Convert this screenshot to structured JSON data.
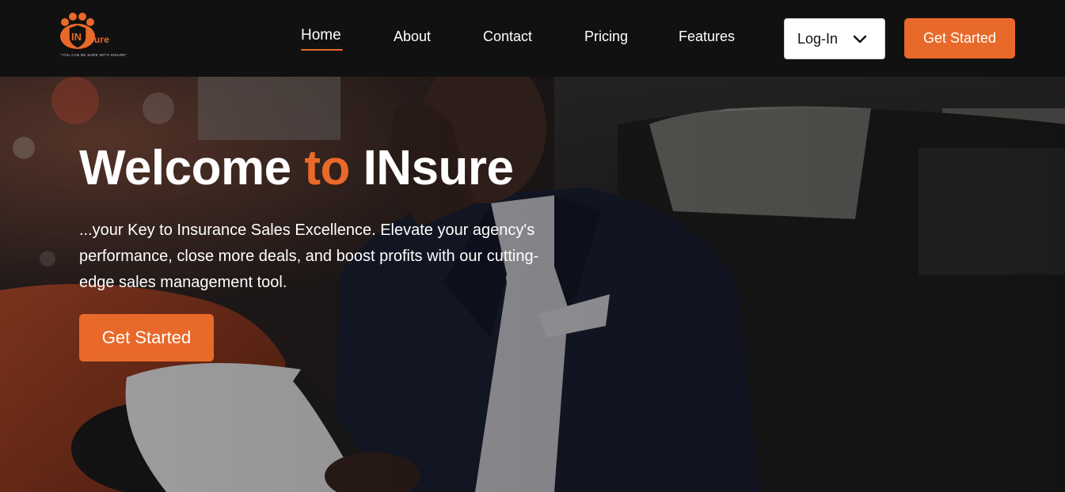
{
  "brand": {
    "logo_text": "INsure",
    "tagline": "\"YOU CAN BE SURE WITH INSURE\"",
    "accent_color": "#e8692a"
  },
  "nav": {
    "items": [
      {
        "label": "Home",
        "active": true
      },
      {
        "label": "About",
        "active": false
      },
      {
        "label": "Contact",
        "active": false
      },
      {
        "label": "Pricing",
        "active": false
      },
      {
        "label": "Features",
        "active": false
      }
    ],
    "login_select": {
      "value": "Log-In",
      "icon": "chevron-down-icon"
    },
    "cta_label": "Get Started"
  },
  "hero": {
    "title_part1": "Welcome",
    "title_accent": "to",
    "title_part2": "INsure",
    "description": "...your Key to Insurance Sales Excellence. Elevate your agency's performance, close more deals, and boost profits with our cutting-edge sales management tool.",
    "cta_label": "Get Started",
    "background_image": "businessman-on-phone-at-car-dealership"
  }
}
